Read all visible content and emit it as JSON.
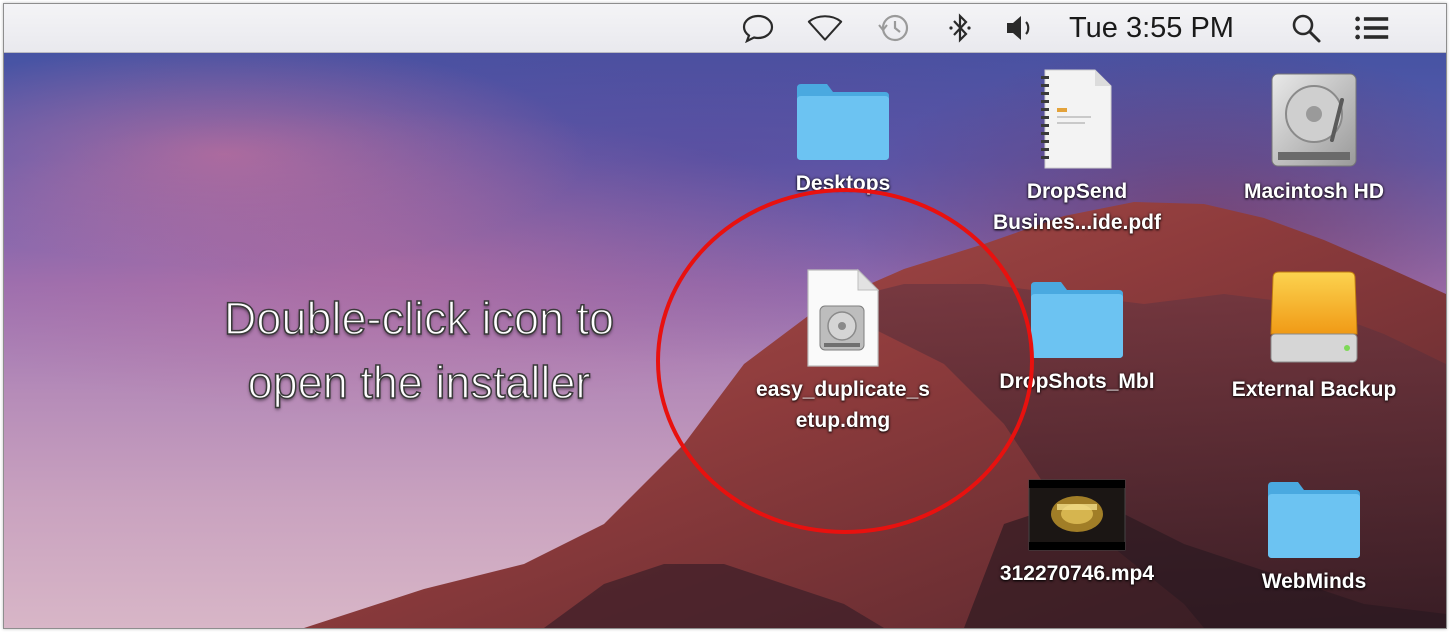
{
  "menubar": {
    "clock": "Tue 3:55 PM",
    "icons": [
      "messages-icon",
      "wifi-icon",
      "time-machine-icon",
      "bluetooth-icon",
      "volume-icon",
      "spotlight-search-icon",
      "notification-center-icon"
    ]
  },
  "annotation": {
    "text": "Double-click icon to\nopen the installer",
    "circle_color": "#e8110f"
  },
  "desktop": {
    "items": [
      {
        "label": "Desktops",
        "icon": "folder-icon"
      },
      {
        "label": "DropSend\nBusines...ide.pdf",
        "icon": "pdf-document-icon"
      },
      {
        "label": "Macintosh HD",
        "icon": "hard-drive-icon"
      },
      {
        "label": "easy_duplicate_s\netup.dmg",
        "icon": "disk-image-icon"
      },
      {
        "label": "DropShots_Mbl",
        "icon": "folder-icon"
      },
      {
        "label": "External Backup",
        "icon": "external-drive-icon"
      },
      {
        "label": "312270746.mp4",
        "icon": "video-thumbnail-icon"
      },
      {
        "label": "WebMinds",
        "icon": "folder-icon"
      }
    ]
  },
  "colors": {
    "folder": "#6cc3f2",
    "menubar": "#eeeef2",
    "external_drive": "#f5b326"
  }
}
